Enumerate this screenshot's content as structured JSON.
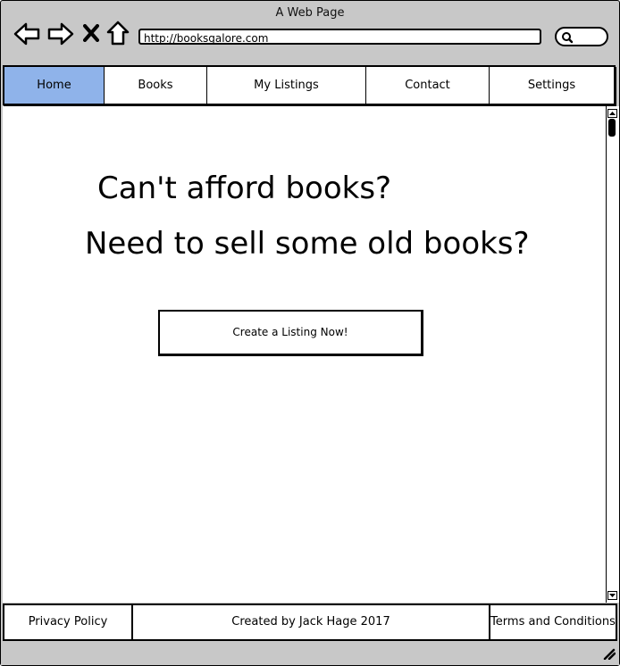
{
  "window": {
    "title": "A Web Page"
  },
  "toolbar": {
    "url": "http://booksgalore.com",
    "icons": [
      "back-icon",
      "forward-icon",
      "close-icon",
      "home-icon",
      "search-icon"
    ]
  },
  "nav": {
    "tabs": [
      {
        "label": "Home",
        "active": true
      },
      {
        "label": "Books"
      },
      {
        "label": "My Listings"
      },
      {
        "label": "Contact"
      },
      {
        "label": "Settings"
      }
    ]
  },
  "hero": {
    "line1": "Can't afford books?",
    "line2": "Need to sell some old books?",
    "cta_label": "Create a Listing Now!"
  },
  "footer": {
    "privacy": "Privacy Policy",
    "credit": "Created by Jack Hage 2017",
    "terms": "Terms and Conditions"
  },
  "colors": {
    "active_tab": "#8fb3ea",
    "chrome": "#c8c8c8"
  }
}
